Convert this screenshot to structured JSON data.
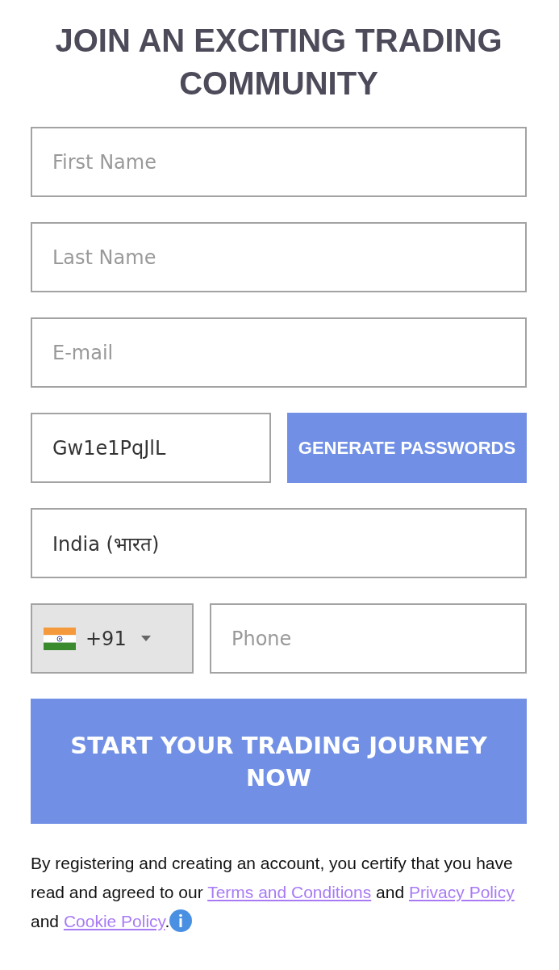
{
  "title": "JOIN AN EXCITING TRADING COMMUNITY",
  "fields": [
    {
      "placeholder": "First Name"
    },
    {
      "placeholder": "Last Name"
    },
    {
      "placeholder": "E-mail"
    }
  ],
  "password": {
    "value": "Gw1e1PqJlL",
    "button": "GENERATE PASSWORDS"
  },
  "country": {
    "value": "India (भारत)"
  },
  "phone": {
    "dial_code": "+91",
    "placeholder": "Phone"
  },
  "submit": "START YOUR TRADING JOURNEY NOW",
  "legal": [
    {
      "kind": "text",
      "text": "By registering and creating an account, you certify that you have read and agreed to our "
    },
    {
      "kind": "link",
      "text": "Terms and Conditions"
    },
    {
      "kind": "text",
      "text": " and "
    },
    {
      "kind": "link",
      "text": "Privacy Policy"
    },
    {
      "kind": "text",
      "text": " and "
    },
    {
      "kind": "link",
      "text": "Cookie Policy"
    },
    {
      "kind": "text",
      "text": "."
    }
  ]
}
